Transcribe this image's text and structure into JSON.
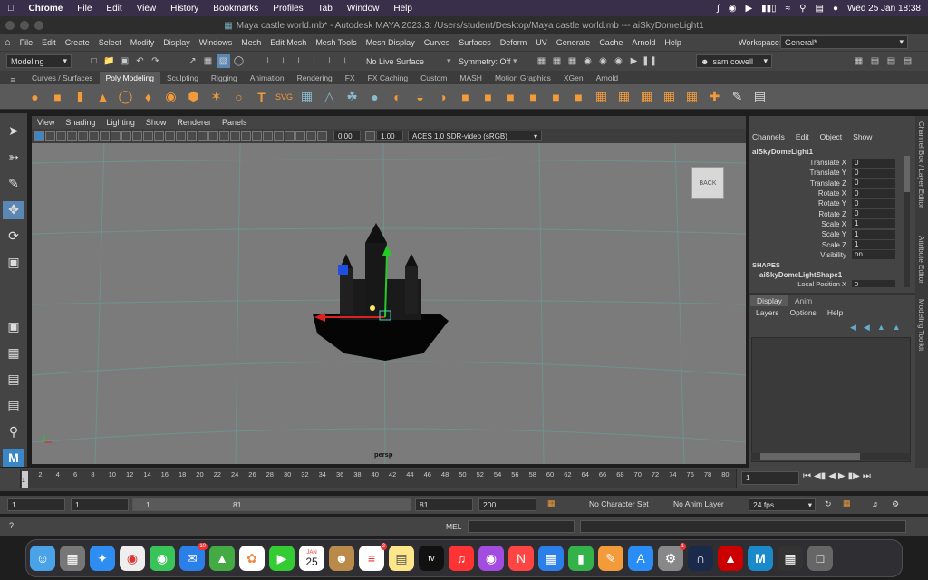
{
  "mac_menubar": {
    "app": "Chrome",
    "items": [
      "File",
      "Edit",
      "View",
      "History",
      "Bookmarks",
      "Profiles",
      "Tab",
      "Window",
      "Help"
    ],
    "clock": "Wed 25 Jan  18:38"
  },
  "window_title": "Maya castle world.mb* - Autodesk MAYA 2023.3: /Users/student/Desktop/Maya castle world.mb   ---   aiSkyDomeLight1",
  "maya_menu": [
    "File",
    "Edit",
    "Create",
    "Select",
    "Modify",
    "Display",
    "Windows",
    "Mesh",
    "Edit Mesh",
    "Mesh Tools",
    "Mesh Display",
    "Curves",
    "Surfaces",
    "Deform",
    "UV",
    "Generate",
    "Cache",
    "Arnold",
    "Help"
  ],
  "workspace": {
    "label": "Workspace:",
    "value": "General*"
  },
  "status_line": {
    "menuset": "Modeling",
    "live_surface": "No Live Surface",
    "symmetry": "Symmetry: Off",
    "user": "sam cowell"
  },
  "shelf_tabs": [
    "Curves / Surfaces",
    "Poly Modeling",
    "Sculpting",
    "Rigging",
    "Animation",
    "Rendering",
    "FX",
    "FX Caching",
    "Custom",
    "MASH",
    "Motion Graphics",
    "XGen",
    "Arnold"
  ],
  "shelf_active": "Poly Modeling",
  "panel_menu": [
    "View",
    "Shading",
    "Lighting",
    "Show",
    "Renderer",
    "Panels"
  ],
  "panel_bar": {
    "value1": "0.00",
    "value2": "1.00",
    "colorspace": "ACES 1.0 SDR-video (sRGB)"
  },
  "viewport": {
    "camera": "persp",
    "viewcube_label": "BACK"
  },
  "channel_box": {
    "menu": [
      "Channels",
      "Edit",
      "Object",
      "Show"
    ],
    "node": "aiSkyDomeLight1",
    "attrs": [
      {
        "name": "Translate X",
        "value": "0"
      },
      {
        "name": "Translate Y",
        "value": "0"
      },
      {
        "name": "Translate Z",
        "value": "0"
      },
      {
        "name": "Rotate X",
        "value": "0"
      },
      {
        "name": "Rotate Y",
        "value": "0"
      },
      {
        "name": "Rotate Z",
        "value": "0"
      },
      {
        "name": "Scale X",
        "value": "1"
      },
      {
        "name": "Scale Y",
        "value": "1"
      },
      {
        "name": "Scale Z",
        "value": "1"
      },
      {
        "name": "Visibility",
        "value": "on"
      }
    ],
    "shapes_header": "SHAPES",
    "shape_node": "aiSkyDomeLightShape1",
    "shape_attr": "Local Position X",
    "shape_attr_value": "0"
  },
  "layer_editor": {
    "tabs": [
      "Display",
      "Anim"
    ],
    "menu": [
      "Layers",
      "Options",
      "Help"
    ]
  },
  "side_tabs": [
    "Channel Box / Layer Editor",
    "Attribute Editor",
    "Modeling Toolkit"
  ],
  "timeline": {
    "ticks": [
      "2",
      "4",
      "6",
      "8",
      "10",
      "12",
      "14",
      "16",
      "18",
      "20",
      "22",
      "24",
      "26",
      "28",
      "30",
      "32",
      "34",
      "36",
      "38",
      "40",
      "42",
      "44",
      "46",
      "48",
      "50",
      "52",
      "54",
      "56",
      "58",
      "60",
      "62",
      "64",
      "66",
      "68",
      "70",
      "72",
      "74",
      "76",
      "78",
      "80"
    ],
    "current_frame": "1",
    "frame_field": "1"
  },
  "range": {
    "start": "1",
    "range_start": "1",
    "slider_start": "1",
    "slider_end": "81",
    "range_end": "81",
    "end": "200",
    "character_set": "No Character Set",
    "anim_layer": "No Anim Layer",
    "fps": "24 fps"
  },
  "cmdline": {
    "label": "MEL"
  },
  "dock": {
    "calendar_month": "JAN",
    "calendar_day": "25",
    "mail_badge": "10",
    "reminders_badge": "2",
    "settings_badge": "1",
    "appletv": "tv"
  }
}
